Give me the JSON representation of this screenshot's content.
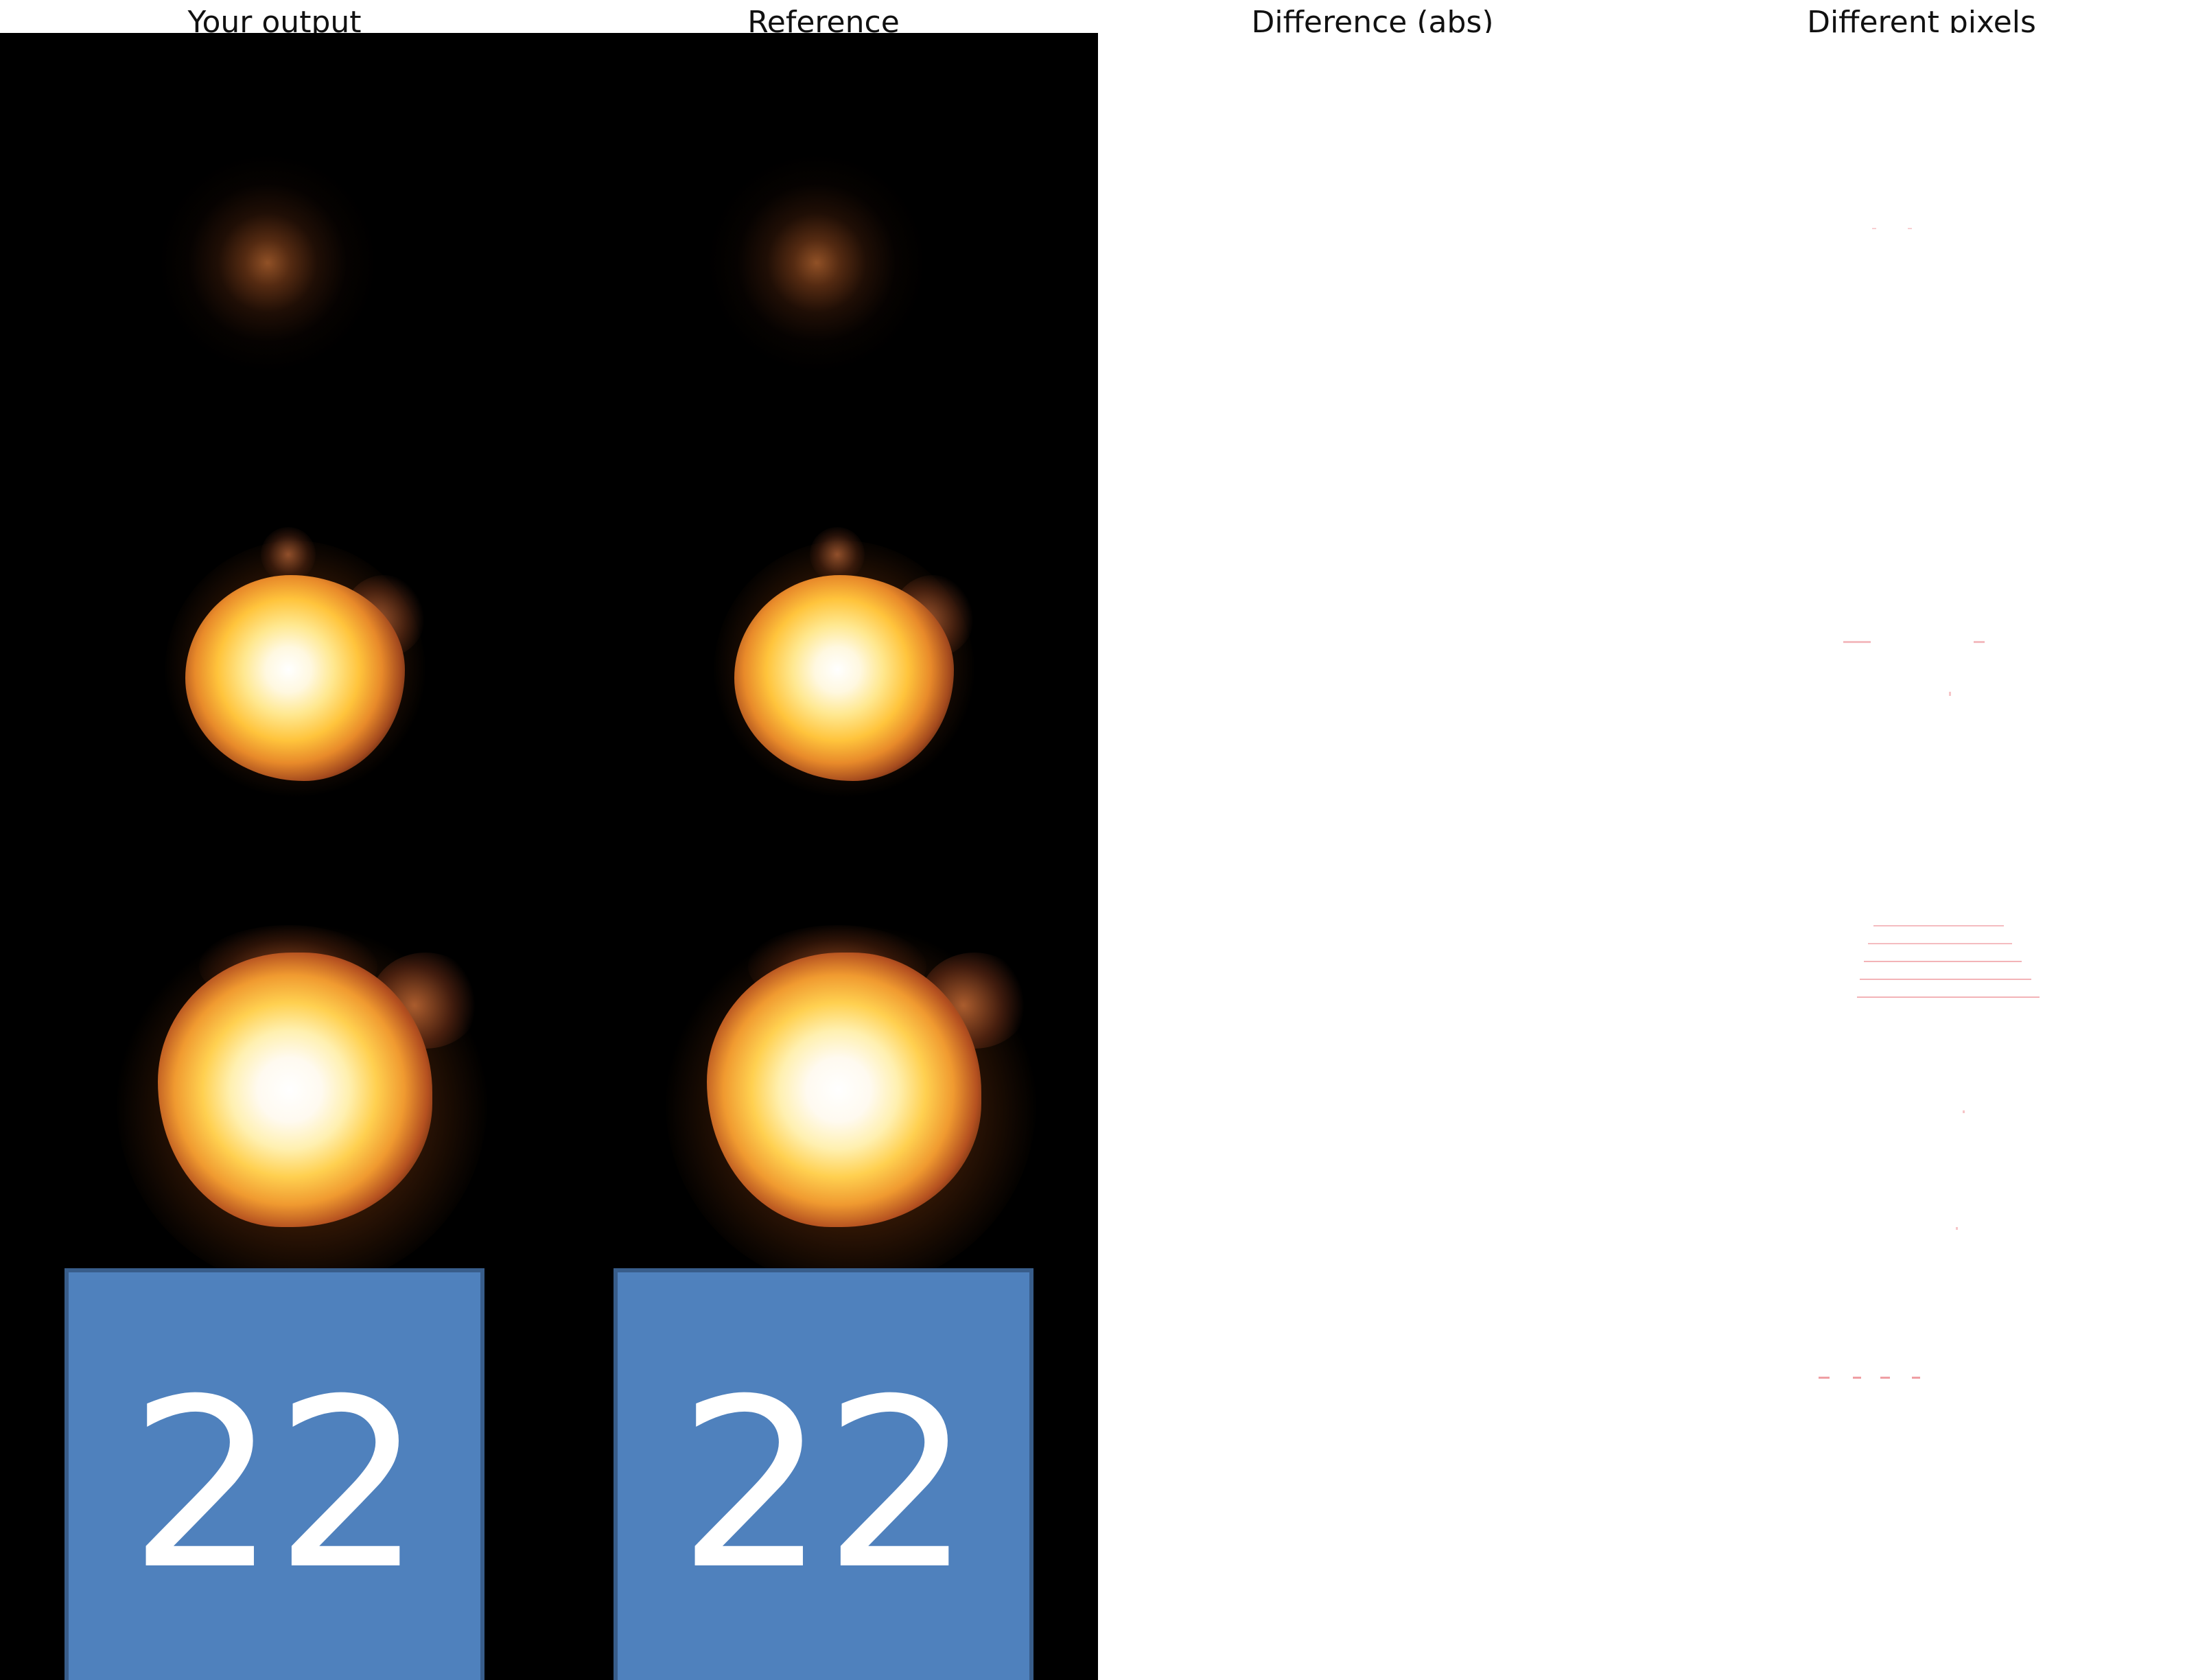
{
  "panels": [
    {
      "title": "Your output"
    },
    {
      "title": "Reference"
    },
    {
      "title": "Difference (abs)"
    },
    {
      "title": "Different pixels"
    }
  ],
  "tile": {
    "number": "22",
    "fill_color": "#4f81bd",
    "border_color": "#385d8a"
  },
  "colors": {
    "scene_background": "#000000",
    "diff_background": "#ffffff",
    "diff_marker": "#e0404a"
  },
  "icons": [
    "explosion-sprite-small",
    "explosion-sprite-medium",
    "explosion-sprite-large"
  ]
}
